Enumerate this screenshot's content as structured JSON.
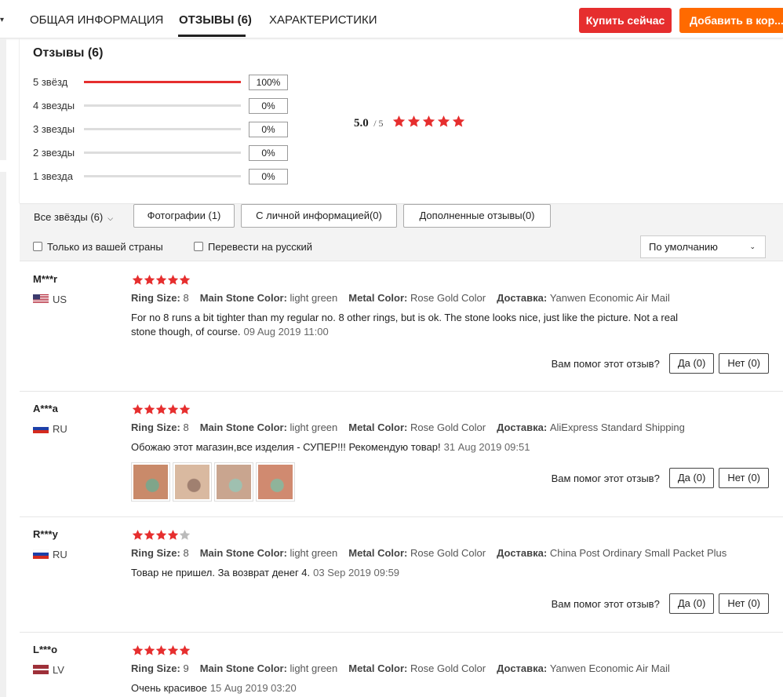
{
  "tabs": {
    "general": "ОБЩАЯ ИНФОРМАЦИЯ",
    "reviews": "ОТЗЫВЫ (6)",
    "specs": "ХАРАКТЕРИСТИКИ"
  },
  "actions": {
    "buy_now": "Купить сейчас",
    "add_to_cart": "Добавить в кор..."
  },
  "summary": {
    "title": "Отзывы (6)",
    "rows": [
      {
        "label": "5 звёзд",
        "percent": "100%",
        "fill": 100
      },
      {
        "label": "4 звезды",
        "percent": "0%",
        "fill": 0
      },
      {
        "label": "3 звезды",
        "percent": "0%",
        "fill": 0
      },
      {
        "label": "2 звезды",
        "percent": "0%",
        "fill": 0
      },
      {
        "label": "1 звезда",
        "percent": "0%",
        "fill": 0
      }
    ],
    "average": "5.0",
    "average_max": "/ 5",
    "average_stars": 5
  },
  "filters": {
    "all_stars": "Все звёзды (6)",
    "photos": "Фотографии (1)",
    "personal": "С личной информацией(0)",
    "additional": "Дополненные отзывы(0)",
    "only_country": "Только из вашей страны",
    "translate": "Перевести на русский",
    "sort": "По умолчанию"
  },
  "labels": {
    "ring_size": "Ring Size:",
    "main_stone": "Main Stone Color:",
    "metal_color": "Metal Color:",
    "delivery": "Доставка:",
    "helpful_q": "Вам помог этот отзыв?",
    "yes": "Да (0)",
    "no": "Нет (0)"
  },
  "reviews": [
    {
      "user": "M***r",
      "country": "US",
      "flag": "us",
      "stars": 5,
      "ring_size": "8",
      "main_stone": "light green",
      "metal_color": "Rose Gold Color",
      "delivery": "Yanwen Economic Air Mail",
      "text": "For no 8 runs a bit tighter than my regular no. 8 other rings, but is ok. The stone looks nice, just like the picture. Not a real stone though, of course.",
      "date": "09 Aug 2019 11:00"
    },
    {
      "user": "A***a",
      "country": "RU",
      "flag": "ru",
      "stars": 5,
      "ring_size": "8",
      "main_stone": "light green",
      "metal_color": "Rose Gold Color",
      "delivery": "AliExpress Standard Shipping",
      "text": "Обожаю этот магазин,все изделия - СУПЕР!!! Рекомендую товар!",
      "date": "31 Aug 2019 09:51",
      "photos": 4
    },
    {
      "user": "R***y",
      "country": "RU",
      "flag": "ru",
      "stars": 4,
      "ring_size": "8",
      "main_stone": "light green",
      "metal_color": "Rose Gold Color",
      "delivery": "China Post Ordinary Small Packet Plus",
      "text": "Товар не пришел. За возврат денег 4.",
      "date": "03 Sep 2019 09:59"
    },
    {
      "user": "L***o",
      "country": "LV",
      "flag": "lv",
      "stars": 5,
      "ring_size": "9",
      "main_stone": "light green",
      "metal_color": "Rose Gold Color",
      "delivery": "Yanwen Economic Air Mail",
      "text": "Очень красивое",
      "date": "15 Aug 2019 03:20"
    }
  ],
  "colors": {
    "star": "#e62e2e",
    "star_empty": "#bbbbbb",
    "buy": "#e62e2e",
    "cart": "#ff6a00"
  }
}
